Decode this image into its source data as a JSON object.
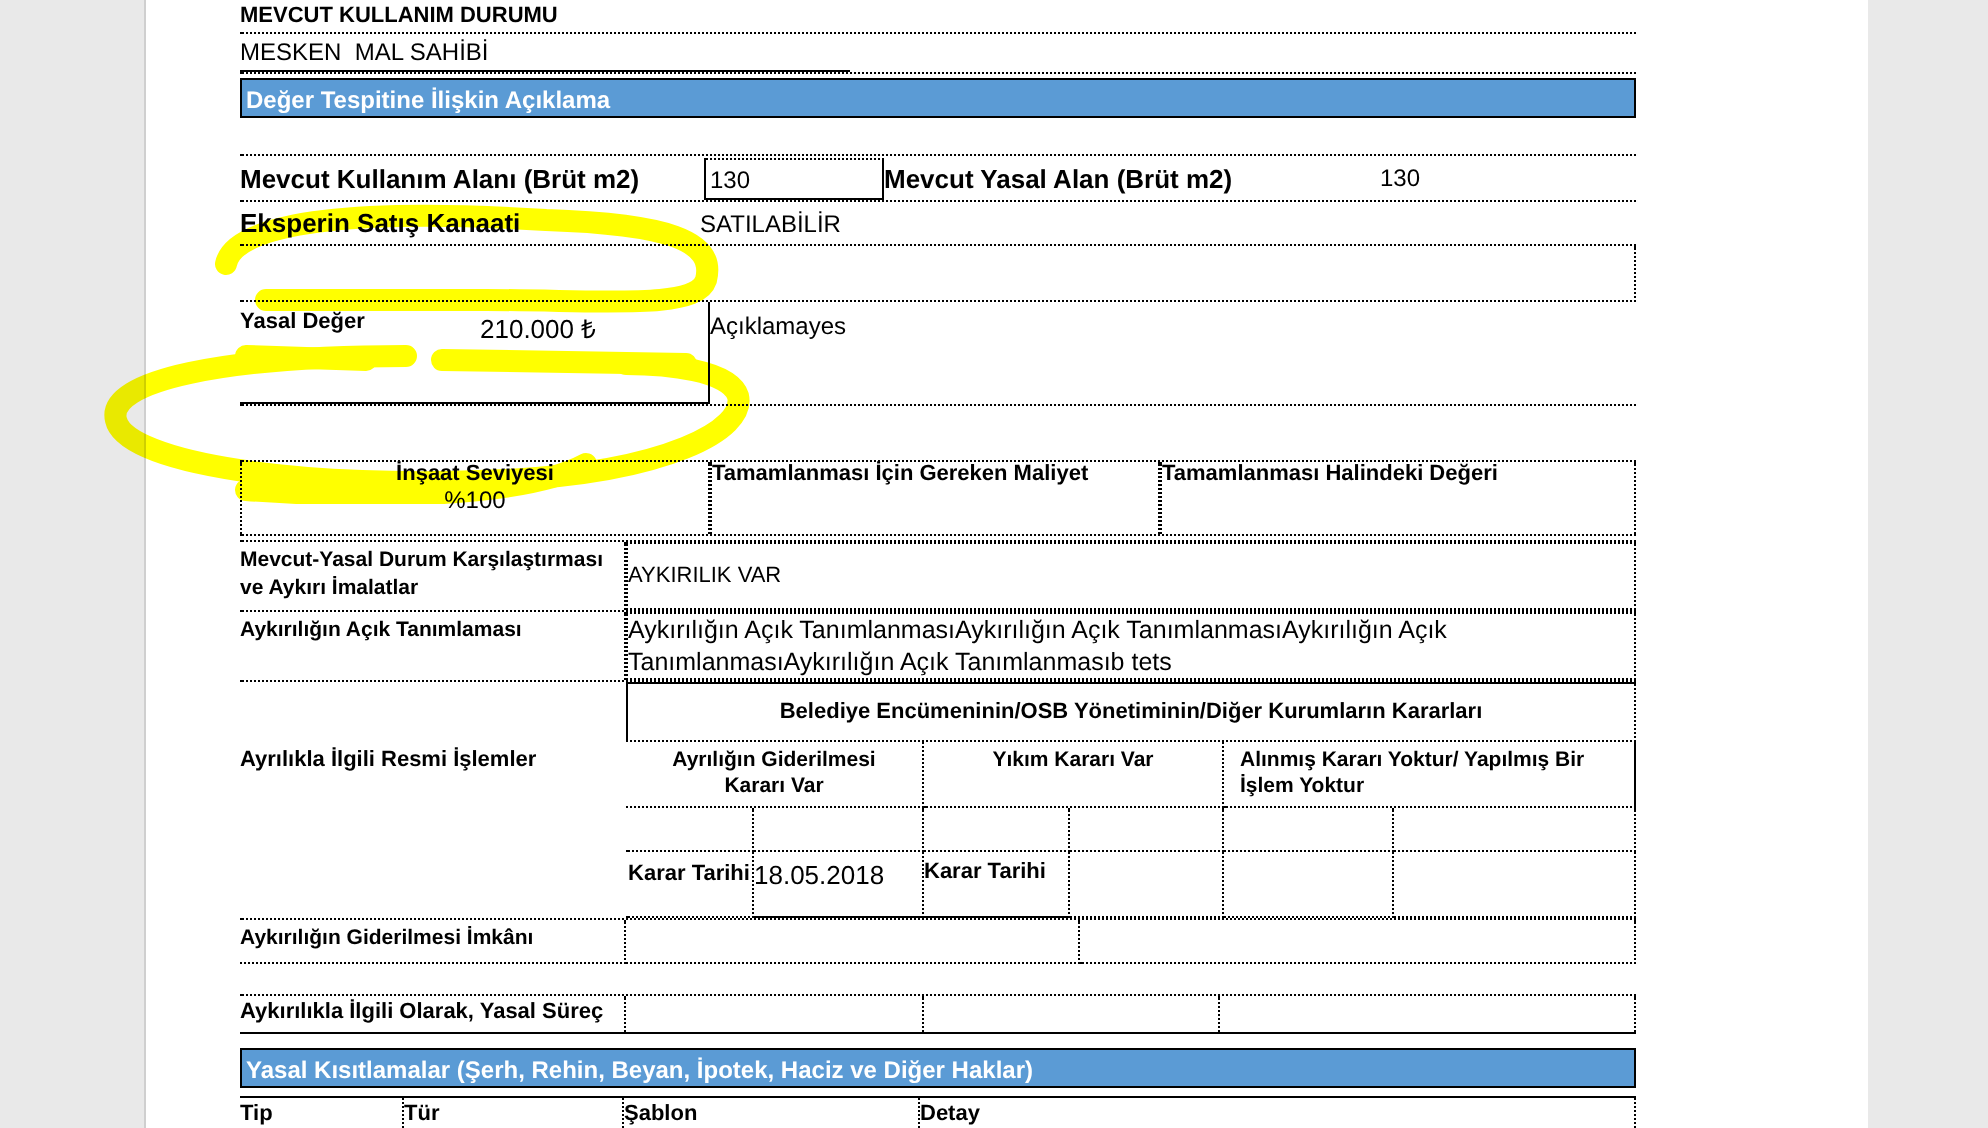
{
  "usage": {
    "heading": "MEVCUT KULLANIM DURUMU",
    "value": "MESKEN  MAL SAHİBİ"
  },
  "valuation": {
    "title": "Değer Tespitine İlişkin Açıklama",
    "areas": [
      {
        "label": "Mevcut Kullanım Alanı (Brüt m2)",
        "value": "130"
      },
      {
        "label": "Mevcut Yasal Alan (Brüt m2)",
        "value": "130"
      }
    ],
    "opinion": {
      "label": "Eksperin Satış Kanaati",
      "value": "SATILABİLİR"
    },
    "legal_value": {
      "label": "Yasal Değer",
      "value": "210.000 ₺"
    },
    "note": "Açıklamayes",
    "construction": [
      {
        "label": "İnşaat Seviyesi",
        "value": "%100"
      },
      {
        "label": "Tamamlanması İçin Gereken Maliyet"
      },
      {
        "label": "Tamamlanması Halindeki Değeri"
      }
    ],
    "comparison": {
      "label": "Mevcut-Yasal Durum Karşılaştırması ve Aykırı İmalatlar",
      "value": "AYKIRILIK VAR"
    },
    "violation_description": {
      "label": "Aykırılığın Açık Tanımlaması",
      "value": "Aykırılığın Açık TanımlanmasıAykırılığın Açık TanımlanmasıAykırılığın Açık TanımlanmasıAykırılığın Açık Tanımlanmasıb tets"
    },
    "official_actions": {
      "label": "Ayrılıkla İlgili Resmi İşlemler",
      "heading": "Belediye Encümeninin/OSB Yönetiminin/Diğer Kurumların Kararları",
      "columns": [
        "Ayrılığın Giderilmesi Kararı Var",
        "Yıkım Kararı Var",
        "Alınmış Kararı Yoktur/ Yapılmış Bir İşlem Yoktur"
      ],
      "dates": [
        {
          "label": "Karar Tarihi",
          "value": "18.05.2018"
        },
        {
          "label": "Karar Tarihi"
        }
      ]
    },
    "remedy": {
      "label": "Aykırılığın Giderilmesi İmkânı"
    },
    "legal_process": {
      "label": "Aykırılıkla İlgili Olarak, Yasal Süreç"
    }
  },
  "restrictions": {
    "title": "Yasal Kısıtlamalar (Şerh, Rehin, Beyan, İpotek, Haciz ve Diğer Haklar)",
    "columns": [
      "Tip",
      "Tür",
      "Şablon",
      "Detay"
    ]
  }
}
